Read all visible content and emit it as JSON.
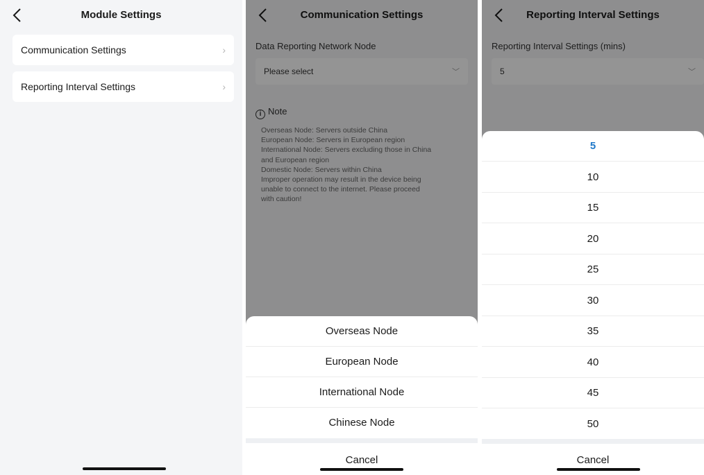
{
  "module_settings": {
    "title": "Module Settings",
    "items": [
      {
        "label": "Communication Settings",
        "chevron": "›"
      },
      {
        "label": "Reporting Interval Settings",
        "chevron": "›"
      }
    ]
  },
  "communication_settings": {
    "title": "Communication Settings",
    "field_label": "Data Reporting Network Node",
    "select_value": "Please select",
    "note_title": "Note",
    "note_lines": [
      "Overseas Node: Servers outside China",
      "European Node: Servers in European region",
      "International Node: Servers excluding those in China",
      "and European region",
      "Domestic Node: Servers within China",
      "Improper operation may result in the device being",
      "unable to connect to the internet. Please proceed",
      "with caution!"
    ],
    "options": [
      "Overseas Node",
      "European Node",
      "International Node",
      "Chinese Node"
    ],
    "cancel": "Cancel"
  },
  "reporting_interval": {
    "title": "Reporting Interval Settings",
    "field_label": "Reporting Interval Settings (mins)",
    "select_value": "5",
    "options": [
      "5",
      "10",
      "15",
      "20",
      "25",
      "30",
      "35",
      "40",
      "45",
      "50"
    ],
    "selected": "5",
    "cancel": "Cancel"
  },
  "colors": {
    "accent": "#1f78c8",
    "page_bg": "#f4f5f7",
    "overlay": "rgba(0,0,0,0.42)"
  },
  "icons": {
    "back": "chevron-left-icon",
    "chevron": "chevron-right-icon",
    "dropdown": "chevron-down-icon",
    "info": "info-icon"
  }
}
